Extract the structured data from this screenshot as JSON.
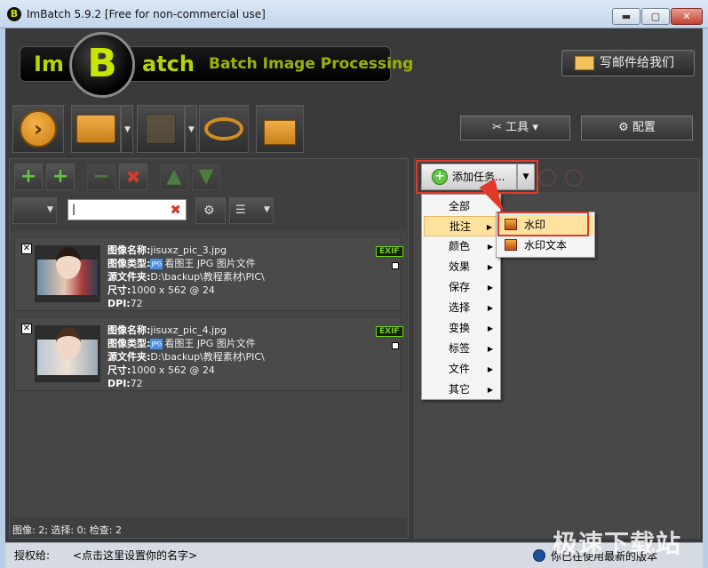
{
  "window": {
    "title": "ImBatch 5.9.2 [Free for non-commercial use]",
    "app_icon_letter": "B",
    "min_glyph": "▬",
    "max_glyph": "▢",
    "close_glyph": "✕"
  },
  "header": {
    "logo_left": "Im",
    "logo_center": "B",
    "logo_right": "atch",
    "subtitle": "Batch Image Processing",
    "mail_button": "写邮件给我们"
  },
  "toolbar": {
    "tools_button": "工具",
    "config_button": "配置"
  },
  "image_list": {
    "search_value": "",
    "items": [
      {
        "name_label": "图像名称:",
        "name": "jisuxz_pic_3.jpg",
        "type_label": "图像类型:",
        "type": "看图王 JPG 图片文件",
        "folder_label": "源文件夹:",
        "folder": "D:\\backup\\教程素材\\PIC\\",
        "size_label": "尺寸:",
        "size": "1000 x 562 @ 24",
        "dpi_label": "DPI:",
        "dpi": "72",
        "exif": "EXIF"
      },
      {
        "name_label": "图像名称:",
        "name": "jisuxz_pic_4.jpg",
        "type_label": "图像类型:",
        "type": "看图王 JPG 图片文件",
        "folder_label": "源文件夹:",
        "folder": "D:\\backup\\教程素材\\PIC\\",
        "size_label": "尺寸:",
        "size": "1000 x 562 @ 24",
        "dpi_label": "DPI:",
        "dpi": "72",
        "exif": "EXIF"
      }
    ],
    "status": "图像: 2; 选择: 0; 检查: 2"
  },
  "tasks": {
    "add_button": "添加任务...",
    "menu": [
      "全部",
      "批注",
      "颜色",
      "效果",
      "保存",
      "选择",
      "变换",
      "标签",
      "文件",
      "其它"
    ],
    "active_menu_index": 1,
    "submenu": [
      "水印",
      "水印文本"
    ]
  },
  "statusbar": {
    "license_label": "授权给:",
    "license_value": "<点击这里设置你的名字>",
    "version_text": "你已在使用最新的版本"
  },
  "watermark": "极速下载站",
  "colors": {
    "accent_green": "#b7d400",
    "highlight_red": "#e23a2a",
    "menu_hover": "#fde2a0"
  }
}
